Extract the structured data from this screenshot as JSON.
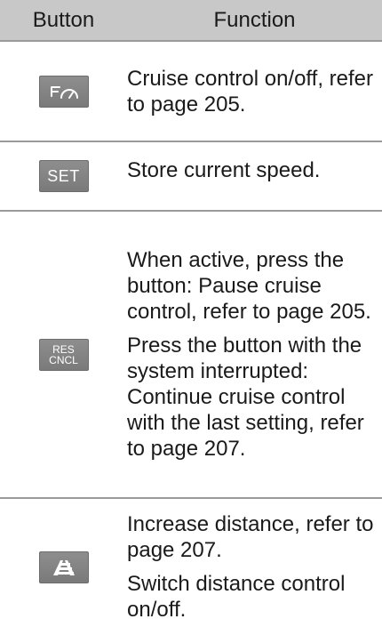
{
  "header": {
    "button_col": "Button",
    "function_col": "Function"
  },
  "rows": [
    {
      "button_icon": "cruise-control-icon",
      "paragraphs": [
        "Cruise control on/off, refer to page 205."
      ]
    },
    {
      "button_label": "SET",
      "paragraphs": [
        "Store current speed."
      ]
    },
    {
      "button_label_line1": "RES",
      "button_label_line2": "CNCL",
      "paragraphs": [
        "When active, press the button: Pause cruise control, refer to page 205.",
        "Press the button with the system interrupted: Continue cruise control with the last setting, refer to page 207."
      ]
    },
    {
      "button_icon": "distance-control-icon",
      "paragraphs": [
        "Increase distance, refer to page 207.",
        "Switch distance control on/off."
      ]
    }
  ]
}
